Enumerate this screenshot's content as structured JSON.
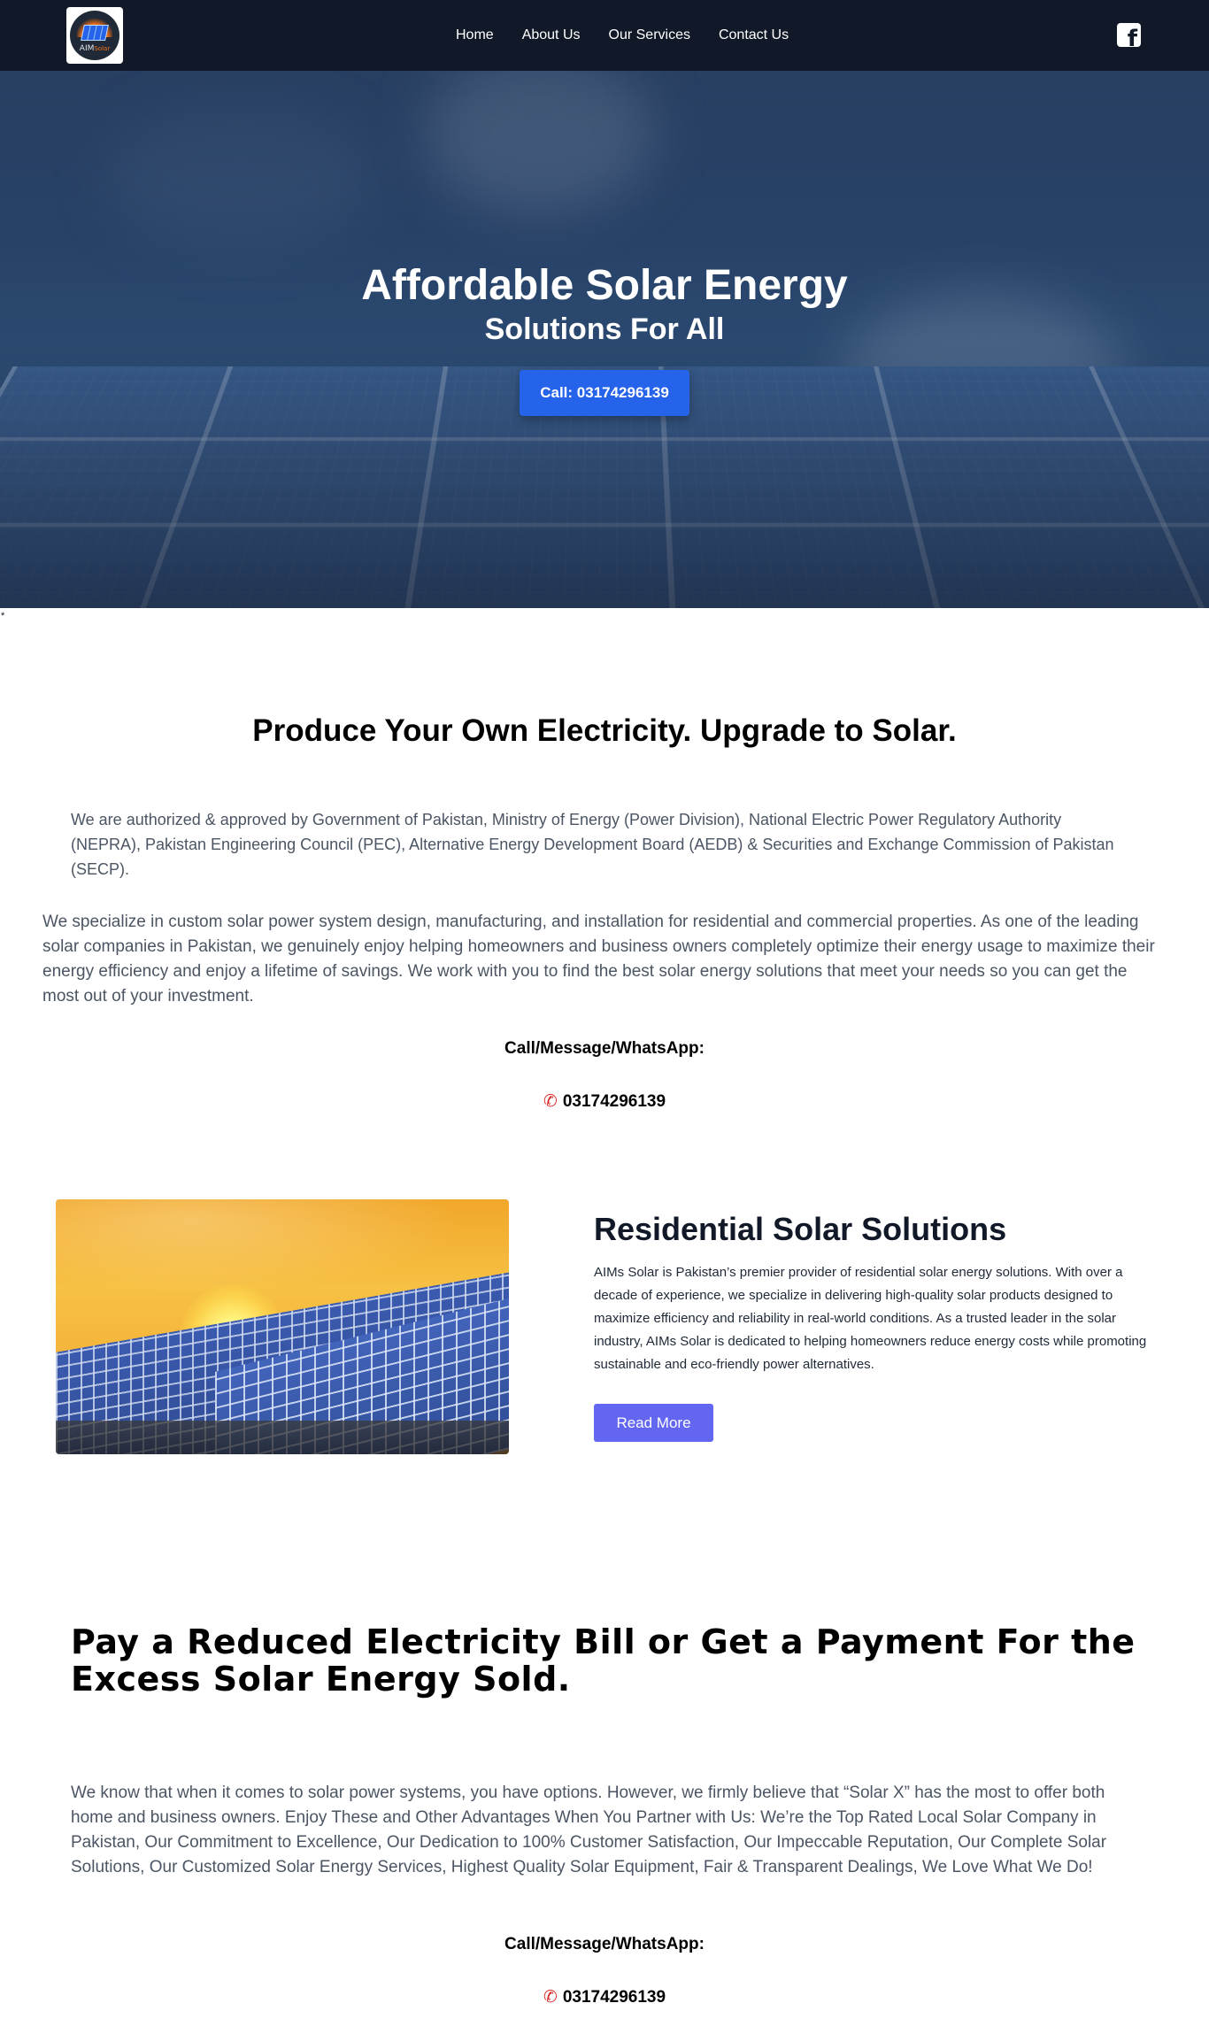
{
  "nav": {
    "logo_text": "AIM",
    "logo_subtext": "Solar",
    "items": [
      {
        "label": "Home"
      },
      {
        "label": "About Us"
      },
      {
        "label": "Our Services"
      },
      {
        "label": "Contact Us"
      }
    ],
    "social_icon": "facebook-icon"
  },
  "hero": {
    "title": "Affordable Solar Energy",
    "subtitle": "Solutions For All",
    "cta_label": "Call: 03174296139",
    "cta_color": "#2563eb"
  },
  "stray_char": "*",
  "intro": {
    "heading": "Produce Your Own Electricity. Upgrade to Solar.",
    "authorization": "We are authorized & approved by Government of Pakistan, Ministry of Energy (Power Division), National Electric Power Regulatory Authority (NEPRA), Pakistan Engineering Council (PEC), Alternative Energy Development Board (AEDB) & Securities and Exchange Commission of Pakistan (SECP).",
    "specialize": "We specialize in custom solar power system design, manufacturing, and installation for residential and commercial properties. As one of the leading solar companies in Pakistan, we genuinely enjoy helping homeowners and business owners completely optimize their energy usage to maximize their energy efficiency and enjoy a lifetime of savings. We work with you to find the best solar energy solutions that meet your needs so you can get the most out of your investment.",
    "contact_label": "Call/Message/WhatsApp:",
    "phone": "03174296139"
  },
  "residential": {
    "title": "Residential Solar Solutions",
    "text": "AIMs Solar is Pakistan’s premier provider of residential solar energy solutions. With over a decade of experience, we specialize in delivering high-quality solar products designed to maximize efficiency and reliability in real-world conditions. As a trusted leader in the solar industry, AIMs Solar is dedicated to helping homeowners reduce energy costs while promoting sustainable and eco-friendly power alternatives.",
    "button_label": "Read More",
    "button_color": "#6366f1"
  },
  "bill": {
    "heading": "Pay a Reduced Electricity Bill or Get a Payment For the Excess Solar Energy Sold.",
    "text": "We know that when it comes to solar power systems, you have options. However, we firmly believe that “Solar X” has the most to offer both home and business owners. Enjoy These and Other Advantages When You Partner with Us: We’re the Top Rated Local Solar Company in Pakistan, Our Commitment to Excellence, Our Dedication to 100% Customer Satisfaction, Our Impeccable Reputation, Our Complete Solar Solutions, Our Customized Solar Energy Services, Highest Quality Solar Equipment, Fair & Transparent Dealings, We Love What We Do!",
    "contact_label": "Call/Message/WhatsApp:",
    "phone": "03174296139"
  }
}
